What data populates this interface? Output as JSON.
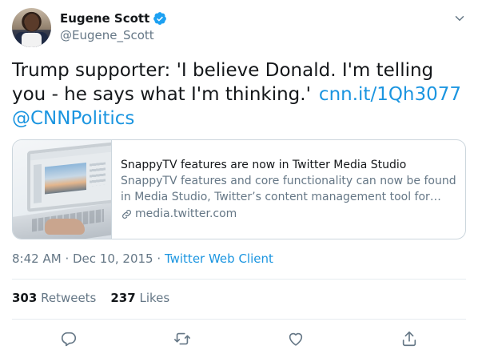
{
  "user": {
    "display_name": "Eugene Scott",
    "handle": "@Eugene_Scott",
    "verified": true
  },
  "tweet": {
    "text": "Trump supporter: 'I believe Donald. I'm telling you - he says what I'm thinking.'",
    "link_text": "cnn.it/1Qh3077",
    "mention_text": "@CNNPolitics"
  },
  "card": {
    "title": "SnappyTV features are now in Twitter Media Studio",
    "description": "SnappyTV features and core functionality can now be found in Media Studio, Twitter’s content management tool for publishers.",
    "domain": "media.twitter.com",
    "image_icon": "laptop-photo"
  },
  "meta": {
    "time": "8:42 AM",
    "separator1": "·",
    "date": "Dec 10, 2015",
    "separator2": "·",
    "source": "Twitter Web Client"
  },
  "stats": {
    "retweets_count": "303",
    "retweets_label": "Retweets",
    "likes_count": "237",
    "likes_label": "Likes"
  },
  "icons": {
    "verified": "verified-badge-icon",
    "menu": "chevron-down-icon",
    "link": "link-icon",
    "reply": "reply-icon",
    "retweet": "retweet-icon",
    "like": "heart-icon",
    "share": "share-icon"
  },
  "colors": {
    "link": "#1b95e0",
    "text": "#14171a",
    "secondary": "#657786",
    "border": "#ccd6dd",
    "verified": "#1da1f2"
  }
}
